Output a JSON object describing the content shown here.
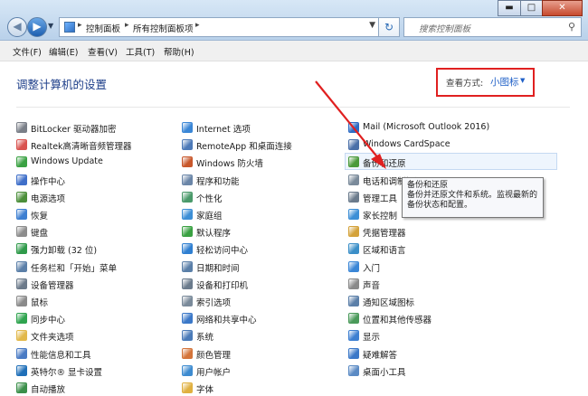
{
  "address_bar": {
    "crumbs": [
      "控制面板",
      "所有控制面板项"
    ]
  },
  "search": {
    "placeholder": "搜索控制面板"
  },
  "menu": [
    "文件(F)",
    "编辑(E)",
    "查看(V)",
    "工具(T)",
    "帮助(H)"
  ],
  "header": {
    "title": "调整计算机的设置",
    "view_label": "查看方式:",
    "view_value": "小图标"
  },
  "columns": [
    [
      {
        "label": "BitLocker 驱动器加密",
        "color": "#7a7f88"
      },
      {
        "label": "Realtek高清晰音频管理器",
        "color": "#d9534f"
      },
      {
        "label": "Windows Update",
        "color": "#3aa142"
      },
      {
        "label": "操作中心",
        "color": "#3f6fc9"
      },
      {
        "label": "电源选项",
        "color": "#4c8f3a"
      },
      {
        "label": "恢复",
        "color": "#3d7fd1"
      },
      {
        "label": "键盘",
        "color": "#8c8c8c"
      },
      {
        "label": "强力卸载 (32 位)",
        "color": "#2f9a4a"
      },
      {
        "label": "任务栏和「开始」菜单",
        "color": "#5b7fa8"
      },
      {
        "label": "设备管理器",
        "color": "#6c7a8a"
      },
      {
        "label": "鼠标",
        "color": "#8a8a8a"
      },
      {
        "label": "同步中心",
        "color": "#2fa44f"
      },
      {
        "label": "文件夹选项",
        "color": "#e2b84a"
      },
      {
        "label": "性能信息和工具",
        "color": "#4a7bc4"
      },
      {
        "label": "英特尔® 显卡设置",
        "color": "#1f6fb8"
      },
      {
        "label": "自动播放",
        "color": "#3b8f4a"
      }
    ],
    [
      {
        "label": "Internet 选项",
        "color": "#3a86d6"
      },
      {
        "label": "RemoteApp 和桌面连接",
        "color": "#4d7ab8"
      },
      {
        "label": "Windows 防火墙",
        "color": "#c8572b"
      },
      {
        "label": "程序和功能",
        "color": "#6b86a8"
      },
      {
        "label": "个性化",
        "color": "#4a9a6a"
      },
      {
        "label": "家庭组",
        "color": "#3d8fd6"
      },
      {
        "label": "默认程序",
        "color": "#3aa142"
      },
      {
        "label": "轻松访问中心",
        "color": "#2f7fd1"
      },
      {
        "label": "日期和时间",
        "color": "#5a7fa8"
      },
      {
        "label": "设备和打印机",
        "color": "#6b7b8c"
      },
      {
        "label": "索引选项",
        "color": "#7a8a9a"
      },
      {
        "label": "网络和共享中心",
        "color": "#3b78c8"
      },
      {
        "label": "系统",
        "color": "#4b7bb8"
      },
      {
        "label": "颜色管理",
        "color": "#d4743a"
      },
      {
        "label": "用户帐户",
        "color": "#3d8bd0"
      },
      {
        "label": "字体",
        "color": "#e0b040"
      }
    ],
    [
      {
        "label": "Mail (Microsoft Outlook 2016)",
        "color": "#2d6bc4"
      },
      {
        "label": "Windows CardSpace",
        "color": "#4a6fa8"
      },
      {
        "label": "备份和还原",
        "color": "#4a9a3a"
      },
      {
        "label": "电话和调制解调器",
        "color": "#7a8a9a"
      },
      {
        "label": "管理工具",
        "color": "#6b7b8c"
      },
      {
        "label": "家长控制",
        "color": "#3d8fd6"
      },
      {
        "label": "凭据管理器",
        "color": "#d4a23a"
      },
      {
        "label": "区域和语言",
        "color": "#3b8fc8"
      },
      {
        "label": "入门",
        "color": "#3a86d6"
      },
      {
        "label": "声音",
        "color": "#8a8a8a"
      },
      {
        "label": "通知区域图标",
        "color": "#5b7fa8"
      },
      {
        "label": "位置和其他传感器",
        "color": "#4a9a5a"
      },
      {
        "label": "显示",
        "color": "#3d7fd1"
      },
      {
        "label": "疑难解答",
        "color": "#3b78c8"
      },
      {
        "label": "桌面小工具",
        "color": "#5a8ac4"
      }
    ]
  ],
  "tooltip": {
    "title": "备份和还原",
    "line1": "备份并还原文件和系统。监视最新的",
    "line2": "备份状态和配置。"
  },
  "colors": {
    "annotation_red": "#e02020",
    "link_blue": "#1e5fc7",
    "title_blue": "#1e3f8a"
  }
}
